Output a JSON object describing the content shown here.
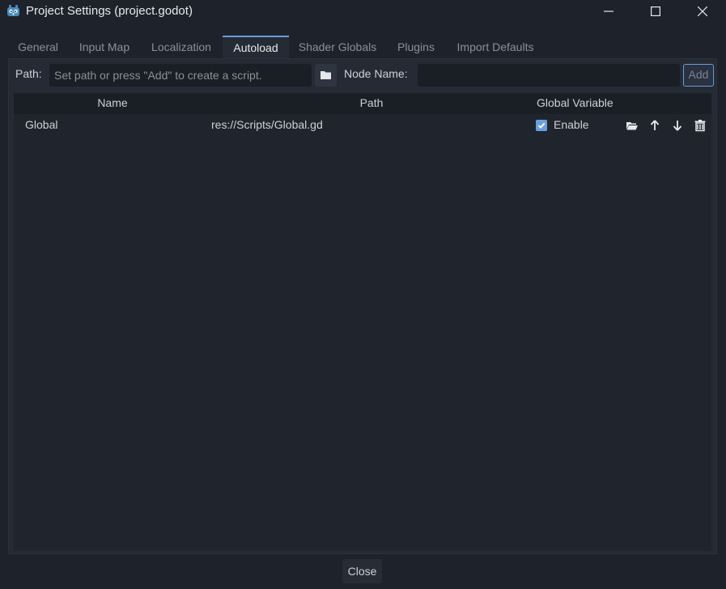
{
  "window": {
    "title": "Project Settings (project.godot)"
  },
  "tabs": [
    {
      "label": "General"
    },
    {
      "label": "Input Map"
    },
    {
      "label": "Localization"
    },
    {
      "label": "Autoload",
      "active": true
    },
    {
      "label": "Shader Globals"
    },
    {
      "label": "Plugins"
    },
    {
      "label": "Import Defaults"
    }
  ],
  "autoload": {
    "path_label": "Path:",
    "path_placeholder": "Set path or press \"Add\" to create a script.",
    "node_name_label": "Node Name:",
    "node_name_value": "",
    "add_label": "Add"
  },
  "table": {
    "headers": {
      "name": "Name",
      "path": "Path",
      "global_variable": "Global Variable"
    },
    "rows": [
      {
        "name": "Global",
        "path": "res://Scripts/Global.gd",
        "enable_label": "Enable",
        "enabled": true
      }
    ]
  },
  "footer": {
    "close_label": "Close"
  },
  "colors": {
    "accent": "#6b9cd6",
    "background": "#1d222b",
    "panel": "#252b34"
  }
}
